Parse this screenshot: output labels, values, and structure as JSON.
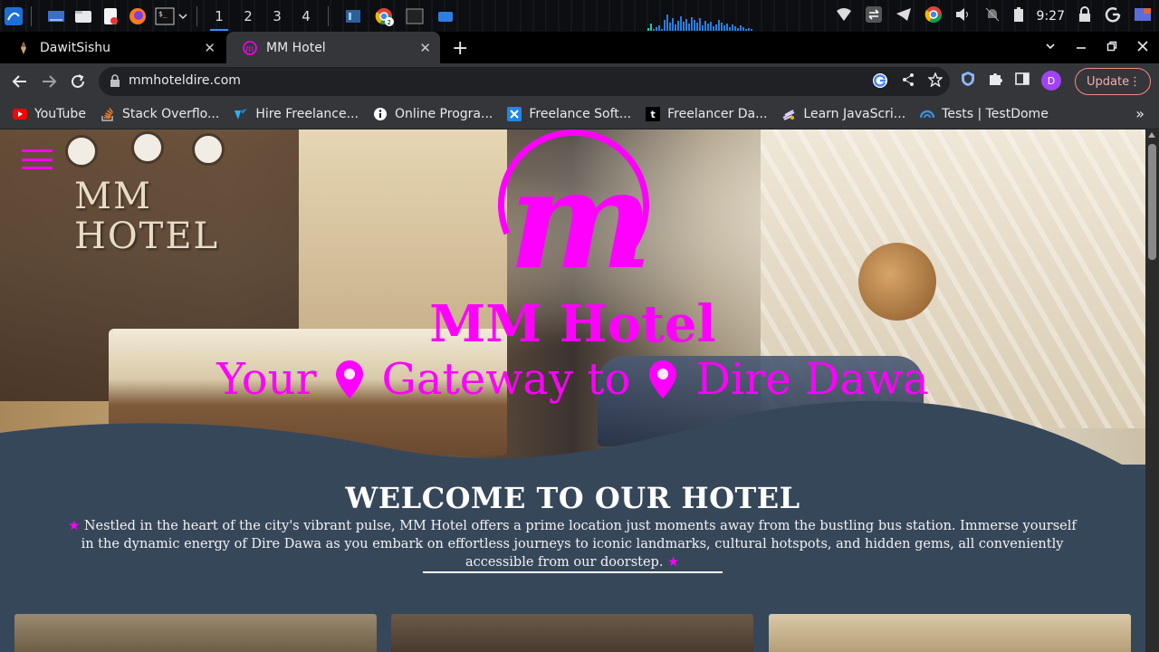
{
  "taskbar": {
    "workspaces": [
      "1",
      "2",
      "3",
      "4"
    ],
    "chrome_badge": "2",
    "clock": "9:27"
  },
  "tabs": [
    {
      "title": "DawitSishu",
      "active": false
    },
    {
      "title": "MM Hotel",
      "active": true
    }
  ],
  "toolbar": {
    "url": "mmhoteldire.com",
    "profile_initial": "D",
    "update_label": "Update"
  },
  "bookmarks": [
    {
      "label": "YouTube",
      "icon": "youtube-icon"
    },
    {
      "label": "Stack Overflo...",
      "icon": "stackoverflow-icon"
    },
    {
      "label": "Hire Freelance...",
      "icon": "upwork-icon"
    },
    {
      "label": "Online Progra...",
      "icon": "info-icon"
    },
    {
      "label": "Freelance Soft...",
      "icon": "x-icon"
    },
    {
      "label": "Freelancer Da...",
      "icon": "t-icon"
    },
    {
      "label": "Learn JavaScri...",
      "icon": "js-icon"
    },
    {
      "label": "Tests | TestDome",
      "icon": "testdome-icon"
    }
  ],
  "hero": {
    "sign": "MM\nHOTEL",
    "title": "MM Hotel",
    "subtitle_parts": [
      "Your",
      "Gateway to",
      "Dire Dawa"
    ]
  },
  "welcome": {
    "heading": "WELCOME TO OUR HOTEL",
    "text": "Nestled in the heart of the city's vibrant pulse, MM Hotel offers a prime location just moments away from the bustling bus station. Immerse yourself in the dynamic energy of Dire Dawa as you embark on effortless journeys to iconic landmarks, cultural hotspots, and hidden gems, all conveniently accessible from our doorstep."
  },
  "colors": {
    "brand_magenta": "#ff00ff",
    "page_bg": "#37475a",
    "chrome_toolbar": "#35363a"
  }
}
